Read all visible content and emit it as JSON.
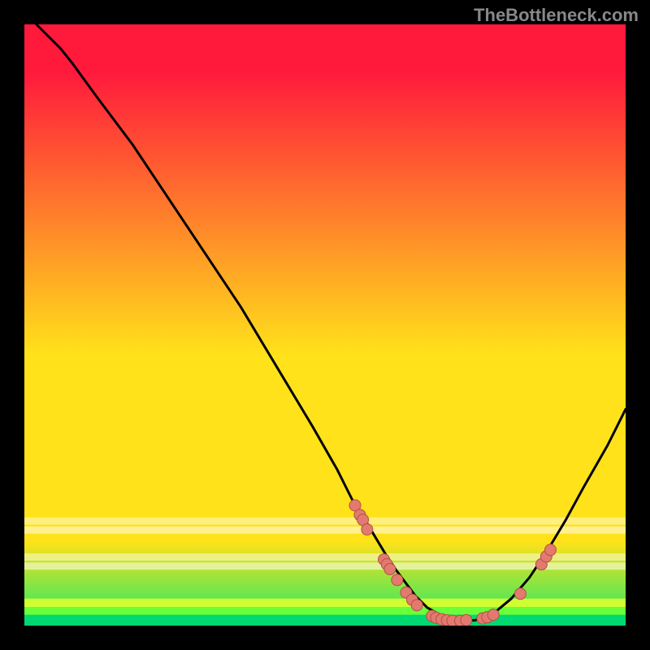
{
  "watermark": "TheBottleneck.com",
  "colors": {
    "background": "#000000",
    "gradient_top": "#ff1a3c",
    "gradient_mid": "#ffe21a",
    "gradient_bottom": "#17e86b",
    "band_green_top": "#cfff33",
    "band_green_mid": "#6bff3a",
    "band_green_bottom": "#00d96f",
    "curve": "#000000",
    "marker_fill": "#e27a6f",
    "marker_stroke": "#b54f45"
  },
  "chart_data": {
    "type": "line",
    "title": "",
    "xlabel": "",
    "ylabel": "",
    "xlim": [
      0,
      100
    ],
    "ylim": [
      0,
      100
    ],
    "curve": {
      "x": [
        2,
        6,
        8,
        12,
        18,
        24,
        30,
        36,
        42,
        48,
        52,
        55,
        57,
        60,
        62,
        65,
        67,
        70,
        72,
        75,
        78,
        81,
        84,
        87,
        90,
        93,
        97,
        100
      ],
      "y": [
        100,
        96,
        93.5,
        88,
        80,
        71,
        62,
        53,
        43,
        33,
        26,
        20,
        17,
        12,
        9,
        5,
        3,
        1.3,
        0.8,
        0.9,
        2,
        4.5,
        8,
        12.5,
        17.5,
        23,
        30,
        36
      ]
    },
    "markers": [
      {
        "x": 55.0,
        "y": 20.0
      },
      {
        "x": 55.8,
        "y": 18.4
      },
      {
        "x": 56.3,
        "y": 17.6
      },
      {
        "x": 57.0,
        "y": 16.0
      },
      {
        "x": 59.8,
        "y": 11.0
      },
      {
        "x": 60.3,
        "y": 10.2
      },
      {
        "x": 60.8,
        "y": 9.4
      },
      {
        "x": 62.0,
        "y": 7.6
      },
      {
        "x": 63.5,
        "y": 5.5
      },
      {
        "x": 64.5,
        "y": 4.3
      },
      {
        "x": 65.3,
        "y": 3.4
      },
      {
        "x": 67.8,
        "y": 1.6
      },
      {
        "x": 68.5,
        "y": 1.3
      },
      {
        "x": 69.4,
        "y": 1.05
      },
      {
        "x": 70.3,
        "y": 0.9
      },
      {
        "x": 71.2,
        "y": 0.8
      },
      {
        "x": 72.5,
        "y": 0.8
      },
      {
        "x": 73.5,
        "y": 0.9
      },
      {
        "x": 76.2,
        "y": 1.2
      },
      {
        "x": 77.0,
        "y": 1.4
      },
      {
        "x": 78.0,
        "y": 1.8
      },
      {
        "x": 82.5,
        "y": 5.3
      },
      {
        "x": 86.0,
        "y": 10.2
      },
      {
        "x": 86.8,
        "y": 11.5
      },
      {
        "x": 87.5,
        "y": 12.6
      }
    ]
  }
}
